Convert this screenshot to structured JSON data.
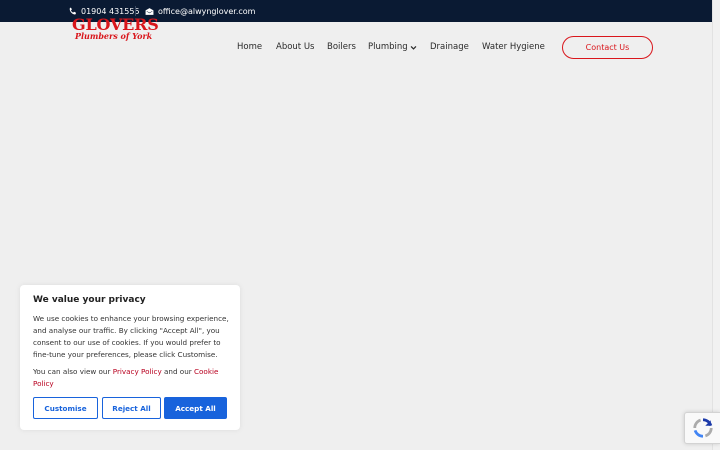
{
  "topbar": {
    "phone": "01904 431555",
    "email": "office@alwynglover.com",
    "phone_icon": "phone-icon",
    "email_icon": "envelope-icon"
  },
  "logo": {
    "line1": "GLOVERS",
    "line2": "Plumbers of York"
  },
  "nav": {
    "home": "Home",
    "about": "About Us",
    "boilers": "Boilers",
    "plumbing": "Plumbing",
    "drainage": "Drainage",
    "water": "Water Hygiene",
    "contact": "Contact Us"
  },
  "cookie": {
    "title": "We value your privacy",
    "body": "We use cookies to enhance your browsing experience, and analyse our traffic. By clicking \"Accept All\", you consent to our use of cookies.  If you would prefer to fine-tune your preferences, please click Customise.",
    "also_prefix": "You can also view our ",
    "privacy_link": "Privacy Policy",
    "and_text": " and our ",
    "cookie_link": "Cookie Policy",
    "customise": "Customise",
    "reject": "Reject All",
    "accept": "Accept All"
  },
  "colors": {
    "topbar_bg": "#0a1a33",
    "brand_red": "#d9161c",
    "consent_blue": "#1863dc",
    "page_bg": "#efefef"
  }
}
